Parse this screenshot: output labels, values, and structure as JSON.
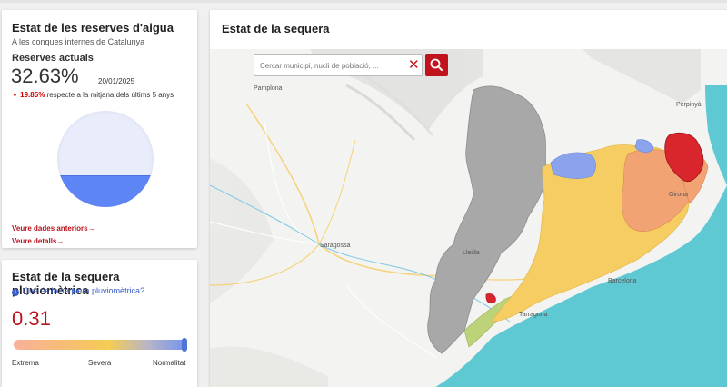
{
  "reserves": {
    "title": "Estat de les reserves d'aigua",
    "subtitle": "A les conques internes de Catalunya",
    "label": "Reserves actuals",
    "value": "32.63%",
    "fill_fraction": 0.3263,
    "date": "20/01/2025",
    "delta": "19.85%",
    "delta_text": "respecte a la mitjana dels últims 5 anys",
    "link_previous": "Veure dades anteriors",
    "link_details": "Veure detalls",
    "link_arrow": "→"
  },
  "sequera": {
    "title": "Estat de la sequera pluviomètrica",
    "info_link": "Què és la sequera pluviomètrica?",
    "value": "0.31",
    "scale": [
      "Extrema",
      "Severa",
      "Normalitat"
    ]
  },
  "map": {
    "title": "Estat de la sequera",
    "search_placeholder": "Cercar municipi, nucli de població, ...",
    "labels": {
      "pamplona": "Pamplona",
      "perpinya": "Perpinyà",
      "girona": "Girona",
      "saragossa": "Saragossa",
      "lleida": "Lleida",
      "barcelona": "Barcelona",
      "tarragona": "Tarragona"
    },
    "colors": {
      "sea": "#5ec8d3",
      "no_data": "#a8a8a8",
      "normal": "#8aa3ec",
      "alert": "#f6cd63",
      "exceptional": "#f2a373",
      "emergency": "#d9262c",
      "pre_alert": "#bcd37a"
    }
  }
}
